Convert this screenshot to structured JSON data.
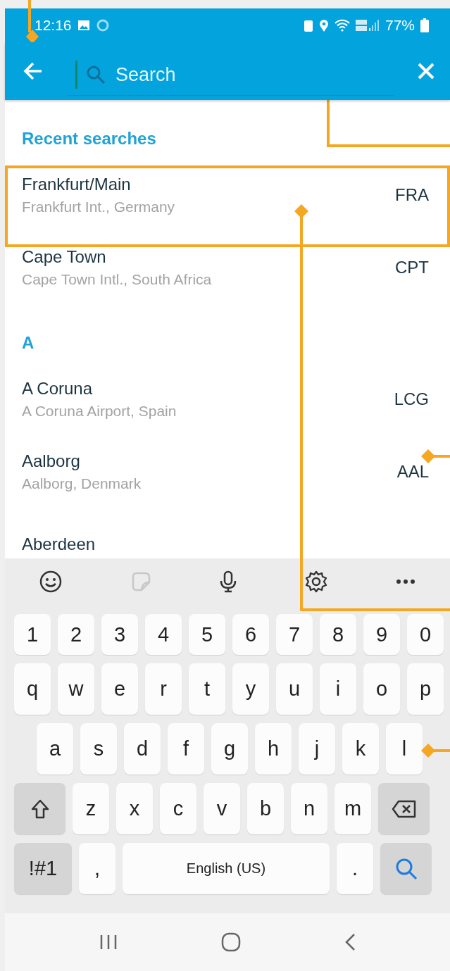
{
  "status_bar": {
    "time": "12:16",
    "battery": "77%"
  },
  "header": {
    "search": {
      "placeholder": "Search"
    }
  },
  "sections": [
    {
      "title": "Recent searches",
      "items": [
        {
          "city": "Frankfurt/Main",
          "airport": "Frankfurt Int., Germany",
          "code": "FRA"
        },
        {
          "city": "Cape Town",
          "airport": "Cape Town Intl., South Africa",
          "code": "CPT"
        }
      ]
    },
    {
      "title": "A",
      "items": [
        {
          "city": "A Coruna",
          "airport": "A Coruna Airport, Spain",
          "code": "LCG"
        },
        {
          "city": "Aalborg",
          "airport": "Aalborg, Denmark",
          "code": "AAL"
        },
        {
          "city": "Aberdeen"
        }
      ]
    }
  ],
  "keyboard": {
    "rows": [
      {
        "keys": [
          {
            "kind": "char",
            "label": "1"
          },
          {
            "kind": "char",
            "label": "2"
          },
          {
            "kind": "char",
            "label": "3"
          },
          {
            "kind": "char",
            "label": "4"
          },
          {
            "kind": "char",
            "label": "5"
          },
          {
            "kind": "char",
            "label": "6"
          },
          {
            "kind": "char",
            "label": "7"
          },
          {
            "kind": "char",
            "label": "8"
          },
          {
            "kind": "char",
            "label": "9"
          },
          {
            "kind": "char",
            "label": "0"
          }
        ]
      },
      {
        "keys": [
          {
            "kind": "char",
            "label": "q"
          },
          {
            "kind": "char",
            "label": "w"
          },
          {
            "kind": "char",
            "label": "e"
          },
          {
            "kind": "char",
            "label": "r"
          },
          {
            "kind": "char",
            "label": "t"
          },
          {
            "kind": "char",
            "label": "y"
          },
          {
            "kind": "char",
            "label": "u"
          },
          {
            "kind": "char",
            "label": "i"
          },
          {
            "kind": "char",
            "label": "o"
          },
          {
            "kind": "char",
            "label": "p"
          }
        ]
      },
      {
        "keys": [
          {
            "kind": "char",
            "label": "a"
          },
          {
            "kind": "char",
            "label": "s"
          },
          {
            "kind": "char",
            "label": "d"
          },
          {
            "kind": "char",
            "label": "f"
          },
          {
            "kind": "char",
            "label": "g"
          },
          {
            "kind": "char",
            "label": "h"
          },
          {
            "kind": "char",
            "label": "j"
          },
          {
            "kind": "char",
            "label": "k"
          },
          {
            "kind": "char",
            "label": "l"
          }
        ]
      },
      {
        "keys": [
          {
            "kind": "shift"
          },
          {
            "kind": "char",
            "label": "z"
          },
          {
            "kind": "char",
            "label": "x"
          },
          {
            "kind": "char",
            "label": "c"
          },
          {
            "kind": "char",
            "label": "v"
          },
          {
            "kind": "char",
            "label": "b"
          },
          {
            "kind": "char",
            "label": "n"
          },
          {
            "kind": "char",
            "label": "m"
          },
          {
            "kind": "backspace"
          }
        ]
      },
      {
        "keys": [
          {
            "kind": "symbols",
            "label": "!#1"
          },
          {
            "kind": "char",
            "label": ","
          },
          {
            "kind": "space",
            "label": "English (US)"
          },
          {
            "kind": "char",
            "label": "."
          },
          {
            "kind": "search"
          }
        ]
      }
    ]
  }
}
